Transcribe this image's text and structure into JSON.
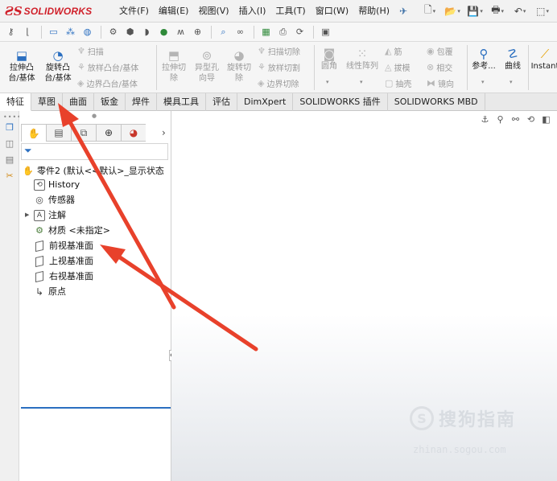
{
  "app": {
    "brand": "SOLIDWORKS",
    "menu": [
      "文件(F)",
      "编辑(E)",
      "视图(V)",
      "插入(I)",
      "工具(T)",
      "窗口(W)",
      "帮助(H)"
    ],
    "quick_access_icons": [
      "new-document-icon",
      "open-icon",
      "save-icon",
      "print-icon",
      "undo-icon",
      "select-icon"
    ]
  },
  "ribbon": {
    "extrude_boss": "拉伸凸\n台/基体",
    "revolve_boss": "旋转凸\n台/基体",
    "sweep": "扫描",
    "loft_boss": "放样凸台/基体",
    "boundary_boss": "边界凸台/基体",
    "extrude_cut": "拉伸切\n除",
    "hole_wizard": "异型孔\n向导",
    "revolve_cut": "旋转切\n除",
    "sweep_cut": "扫描切除",
    "loft_cut": "放样切割",
    "boundary_cut": "边界切除",
    "fillet": "圆角",
    "linear_pattern": "线性阵列",
    "rib": "筋",
    "draft": "拔模",
    "shell": "抽壳",
    "wrap": "包覆",
    "intersect": "相交",
    "mirror": "镜向",
    "reference": "参考...",
    "curves": "曲线",
    "instant3d": "Instant"
  },
  "tabs": [
    "特征",
    "草图",
    "曲面",
    "钣金",
    "焊件",
    "模具工具",
    "评估",
    "DimXpert",
    "SOLIDWORKS 插件",
    "SOLIDWORKS MBD"
  ],
  "active_tab": "特征",
  "feature_tree": {
    "part": "零件2 (默认<<默认>_显示状态",
    "items": [
      {
        "label": "History",
        "icon": "history-icon"
      },
      {
        "label": "传感器",
        "icon": "sensor-icon"
      },
      {
        "label": "注解",
        "icon": "annotation-icon"
      },
      {
        "label": "材质 <未指定>",
        "icon": "material-icon"
      },
      {
        "label": "前视基准面",
        "icon": "plane-icon"
      },
      {
        "label": "上视基准面",
        "icon": "plane-icon"
      },
      {
        "label": "右视基准面",
        "icon": "plane-icon"
      },
      {
        "label": "原点",
        "icon": "origin-icon"
      }
    ]
  },
  "watermark": {
    "brand": "搜狗指南",
    "url": "zhinan.sogou.com"
  },
  "colors": {
    "brand_red": "#d0202a",
    "annotation_arrow": "#e8412b",
    "accent_blue": "#2b6fc0"
  }
}
